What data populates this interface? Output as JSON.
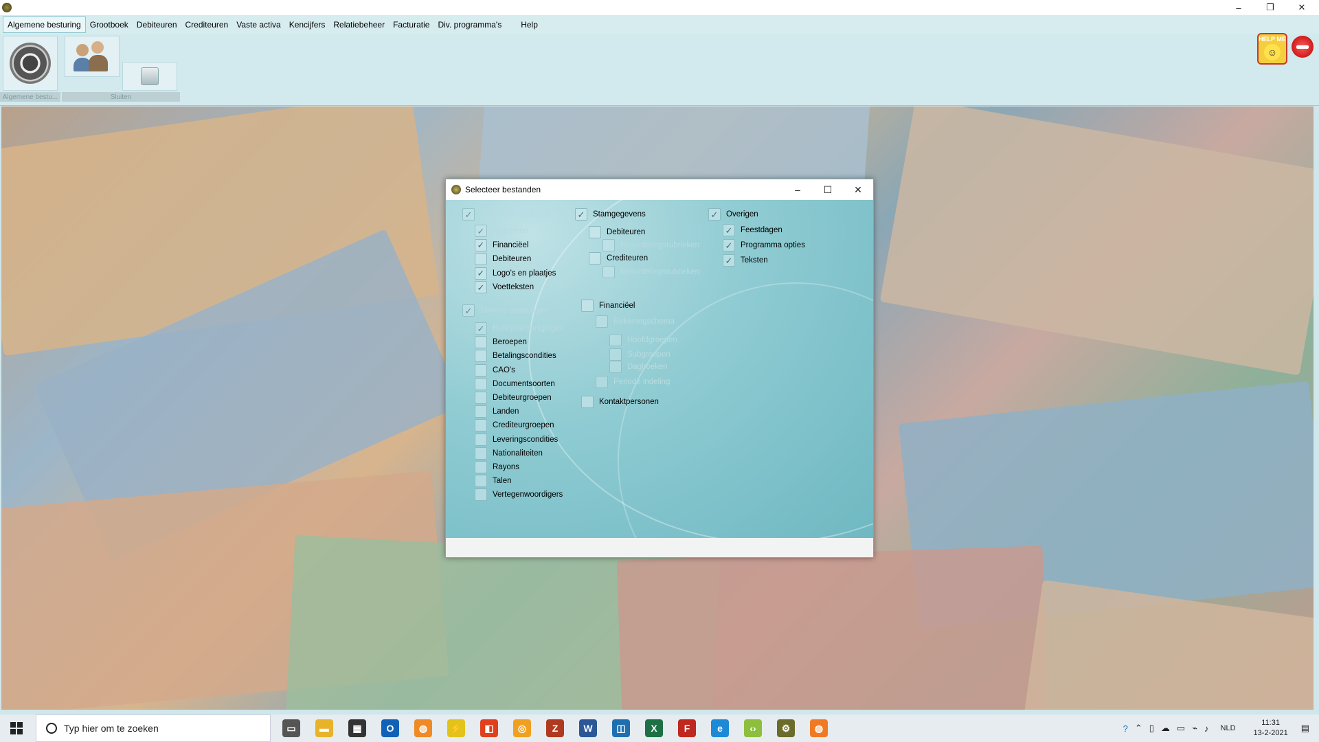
{
  "window": {
    "controls": {
      "minimize": "–",
      "restore": "❐",
      "close": "✕"
    }
  },
  "menu": {
    "items": [
      "Algemene besturing",
      "Grootboek",
      "Debiteuren",
      "Crediteuren",
      "Vaste activa",
      "Kencijfers",
      "Relatiebeheer",
      "Facturatie",
      "Div. programma's",
      "Help"
    ]
  },
  "ribbon": {
    "group1": "Algemene bestu...",
    "group2": "Sluiten"
  },
  "help_button": {
    "label": "HELP ME"
  },
  "dialog": {
    "title": "Selecteer bestanden",
    "controls": {
      "minimize": "–",
      "maximize": "☐",
      "close": "✕"
    },
    "col1": {
      "group1": {
        "label": "Algemene besturing",
        "checked": true,
        "disabled": true
      },
      "group1_items": [
        {
          "label": "Algemeen",
          "checked": true,
          "disabled": true
        },
        {
          "label": "Financiëel",
          "checked": true,
          "disabled": false
        },
        {
          "label": "Debiteuren",
          "checked": false,
          "disabled": false
        },
        {
          "label": "Logo's en plaatjes",
          "checked": true,
          "disabled": false
        },
        {
          "label": "Voetteksten",
          "checked": true,
          "disabled": false
        }
      ],
      "group2": {
        "label": "Diverse coderingen",
        "checked": true,
        "disabled": true
      },
      "group2_items": [
        {
          "label": "Bedrijfsverenigingen",
          "checked": true,
          "disabled": true
        },
        {
          "label": "Beroepen",
          "checked": false,
          "disabled": false
        },
        {
          "label": "Betalingscondities",
          "checked": false,
          "disabled": false
        },
        {
          "label": "CAO's",
          "checked": false,
          "disabled": false
        },
        {
          "label": "Documentsoorten",
          "checked": false,
          "disabled": false
        },
        {
          "label": "Debiteurgroepen",
          "checked": false,
          "disabled": false
        },
        {
          "label": "Landen",
          "checked": false,
          "disabled": false
        },
        {
          "label": "Crediteurgroepen",
          "checked": false,
          "disabled": false
        },
        {
          "label": "Leveringscondities",
          "checked": false,
          "disabled": false
        },
        {
          "label": "Nationaliteiten",
          "checked": false,
          "disabled": false
        },
        {
          "label": "Rayons",
          "checked": false,
          "disabled": false
        },
        {
          "label": "Talen",
          "checked": false,
          "disabled": false
        },
        {
          "label": "Vertegenwoordigers",
          "checked": false,
          "disabled": false
        }
      ]
    },
    "col2": {
      "stamgegevens": {
        "label": "Stamgegevens",
        "checked": true
      },
      "debiteuren": {
        "label": "Debiteuren",
        "checked": false
      },
      "deb_beoordeling": {
        "label": "Beoordelingsrubrieken",
        "checked": false
      },
      "crediteuren": {
        "label": "Crediteuren",
        "checked": false
      },
      "cred_beoordeling": {
        "label": "Beoordelingsrubrieken",
        "checked": false
      },
      "financieel": {
        "label": "Financiëel",
        "checked": false
      },
      "rekeningschema": {
        "label": "Rekeningschema",
        "checked": false
      },
      "hoofdgroepen": {
        "label": "Hoofdgroepen",
        "checked": false
      },
      "subgroepen": {
        "label": "Subgroepen",
        "checked": false
      },
      "dagboeken": {
        "label": "Dagboeken",
        "checked": false
      },
      "periode": {
        "label": "Periode indeling",
        "checked": false
      },
      "kontaktpersonen": {
        "label": "Kontaktpersonen",
        "checked": false
      }
    },
    "col3": {
      "overigen": {
        "label": "Overigen",
        "checked": true
      },
      "items": [
        {
          "label": "Feestdagen",
          "checked": true
        },
        {
          "label": "Programma opties",
          "checked": true
        },
        {
          "label": "Teksten",
          "checked": true
        }
      ]
    },
    "buttons": {
      "list": "☰",
      "cancel": "✖",
      "ok": "✔"
    },
    "button_colors": {
      "cancel": "#e01010",
      "ok": "#2a9a2a"
    }
  },
  "taskbar": {
    "search_placeholder": "Typ hier om te zoeken",
    "apps": [
      {
        "name": "task-view",
        "color": "#555",
        "glyph": "▭"
      },
      {
        "name": "file-explorer",
        "color": "#e8b32a",
        "glyph": "▬"
      },
      {
        "name": "store",
        "color": "#333",
        "glyph": "▦"
      },
      {
        "name": "outlook",
        "color": "#0f62b8",
        "glyph": "O"
      },
      {
        "name": "app-orange",
        "color": "#f08a24",
        "glyph": "◍"
      },
      {
        "name": "app-yellow",
        "color": "#e3c21b",
        "glyph": "⚡"
      },
      {
        "name": "office",
        "color": "#e0401c",
        "glyph": "◧"
      },
      {
        "name": "app-ring",
        "color": "#f0a020",
        "glyph": "◎"
      },
      {
        "name": "filezilla-server",
        "color": "#b03a1f",
        "glyph": "Z"
      },
      {
        "name": "word",
        "color": "#2b5797",
        "glyph": "W"
      },
      {
        "name": "app-blue",
        "color": "#1f6fb0",
        "glyph": "◫"
      },
      {
        "name": "excel",
        "color": "#1d7044",
        "glyph": "X"
      },
      {
        "name": "filezilla",
        "color": "#c0271e",
        "glyph": "F"
      },
      {
        "name": "edge",
        "color": "#1d8ad6",
        "glyph": "e"
      },
      {
        "name": "app-green",
        "color": "#8dbf3d",
        "glyph": "‹›"
      },
      {
        "name": "app-current",
        "color": "#6b6b2a",
        "glyph": "⚙"
      },
      {
        "name": "app-orange2",
        "color": "#f07a24",
        "glyph": "◍"
      }
    ],
    "tray": {
      "language": "NLD",
      "time": "11:31",
      "date": "13-2-2021"
    }
  }
}
